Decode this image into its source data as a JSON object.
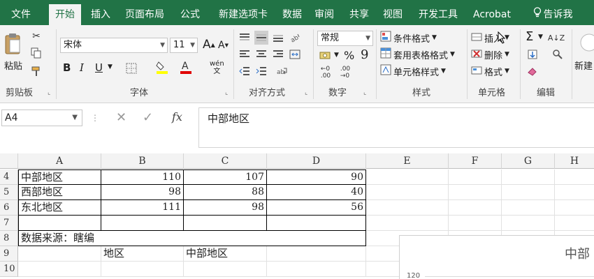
{
  "tabs": {
    "file": "文件",
    "home": "开始",
    "insert": "插入",
    "layout": "页面布局",
    "formula": "公式",
    "newtab": "新建选项卡",
    "data": "数据",
    "review": "审阅",
    "share": "共享",
    "view": "视图",
    "dev": "开发工具",
    "acrobat": "Acrobat",
    "tell": "告诉我"
  },
  "ribbon": {
    "clipboard": {
      "paste": "粘贴",
      "label": "剪贴板"
    },
    "font": {
      "name": "宋体",
      "size": "11",
      "bold": "B",
      "italic": "I",
      "underline": "U",
      "label": "字体",
      "grow": "A",
      "shrink": "A",
      "wen": "wén"
    },
    "alignment": {
      "label": "对齐方式"
    },
    "number": {
      "format": "常规",
      "percent": "%",
      "comma": "9",
      "label": "数字"
    },
    "styles": {
      "conditional": "条件格式",
      "table": "套用表格格式",
      "cell": "单元格样式",
      "label": "样式"
    },
    "cells": {
      "insert": "插入",
      "delete": "删除",
      "format": "格式",
      "label": "单元格"
    },
    "editing": {
      "sum": "Σ",
      "label": "编辑"
    },
    "new": {
      "label": "新建"
    }
  },
  "namebox": "A4",
  "formula_value": "中部地区",
  "columns": [
    "A",
    "B",
    "C",
    "D",
    "E",
    "F",
    "G",
    "H"
  ],
  "rows": [
    {
      "num": "4",
      "a": "中部地区",
      "b": "110",
      "c": "107",
      "d": "90"
    },
    {
      "num": "5",
      "a": "西部地区",
      "b": "98",
      "c": "88",
      "d": "40"
    },
    {
      "num": "6",
      "a": "东北地区",
      "b": "111",
      "c": "98",
      "d": "56"
    },
    {
      "num": "7",
      "a": "",
      "b": "",
      "c": "",
      "d": ""
    },
    {
      "num": "8",
      "a": "数据来源：瞎编"
    },
    {
      "num": "9",
      "b": "地区",
      "c": "中部地区"
    },
    {
      "num": "10"
    }
  ],
  "chart": {
    "title": "中部",
    "ytick": "120"
  },
  "colors": {
    "accent": "#217346"
  }
}
